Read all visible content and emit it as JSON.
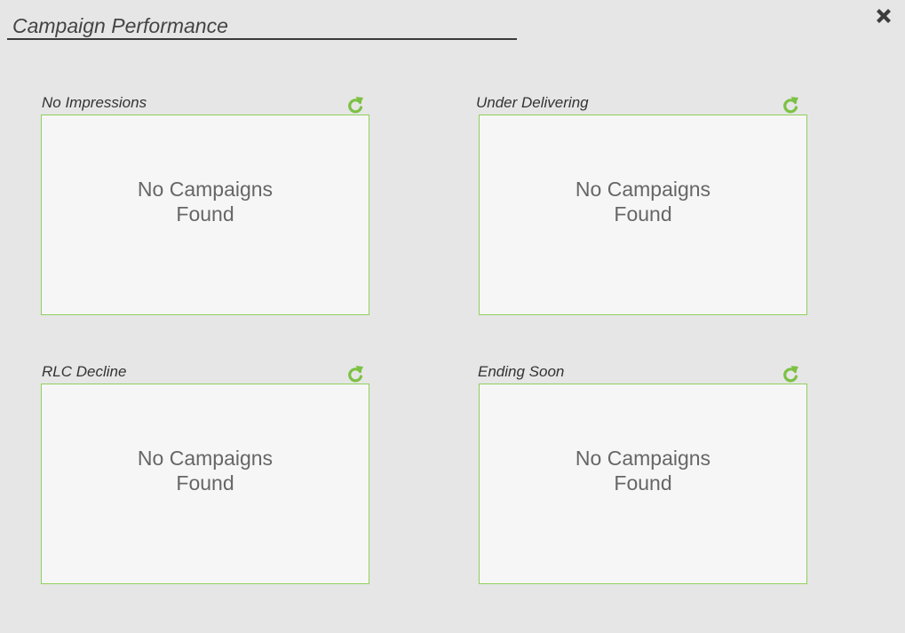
{
  "header": {
    "title": "Campaign Performance",
    "close_icon": "close-icon"
  },
  "colors": {
    "background": "#e6e6e6",
    "panel_border": "#8fd05a",
    "refresh_icon": "#7cc144",
    "empty_text": "#666666"
  },
  "panels": [
    {
      "label": "No Impressions",
      "empty_message": "No Campaigns Found",
      "icon": "refresh-icon"
    },
    {
      "label": "Under Delivering",
      "empty_message": "No Campaigns Found",
      "icon": "refresh-icon"
    },
    {
      "label": "RLC Decline",
      "empty_message": "No Campaigns Found",
      "icon": "refresh-icon"
    },
    {
      "label": "Ending Soon",
      "empty_message": "No Campaigns Found",
      "icon": "refresh-icon"
    }
  ]
}
